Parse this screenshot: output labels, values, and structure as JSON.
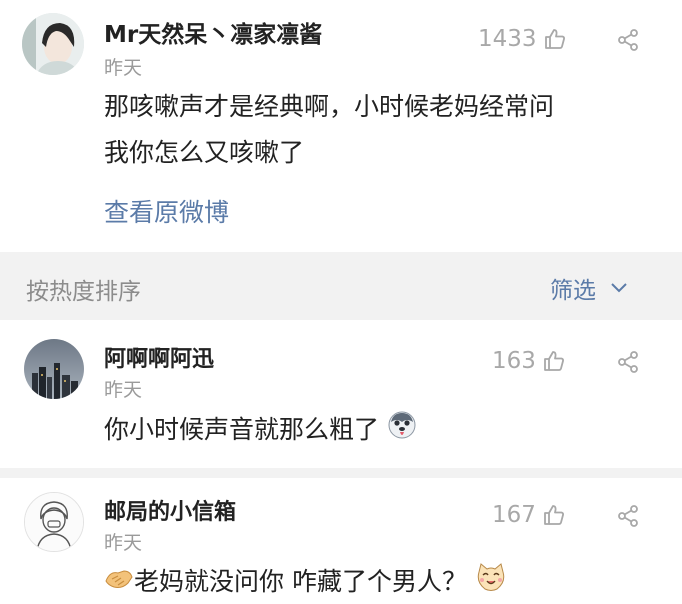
{
  "post": {
    "username": "Mr天然呆丶凛家凛酱",
    "time": "昨天",
    "likes": "1433",
    "text_line1": "那咳嗽声才是经典啊，小时候老妈经常问",
    "text_line2": "我你怎么又咳嗽了",
    "view_original": "查看原微博"
  },
  "sort_bar": {
    "label": "按热度排序",
    "filter_label": "筛选"
  },
  "comments": [
    {
      "username": "阿啊啊阿迅",
      "time": "昨天",
      "likes": "163",
      "text": "你小时候声音就那么粗了",
      "emoji": "husky-emoji"
    },
    {
      "username": "邮局的小信箱",
      "time": "昨天",
      "likes": "167",
      "text": "老妈就没问你 咋藏了个男人？",
      "emoji": "cat-emoji"
    }
  ],
  "colors": {
    "link": "#5b7ba8",
    "muted": "#9a9a9a",
    "separator": "#f2f2f2"
  }
}
